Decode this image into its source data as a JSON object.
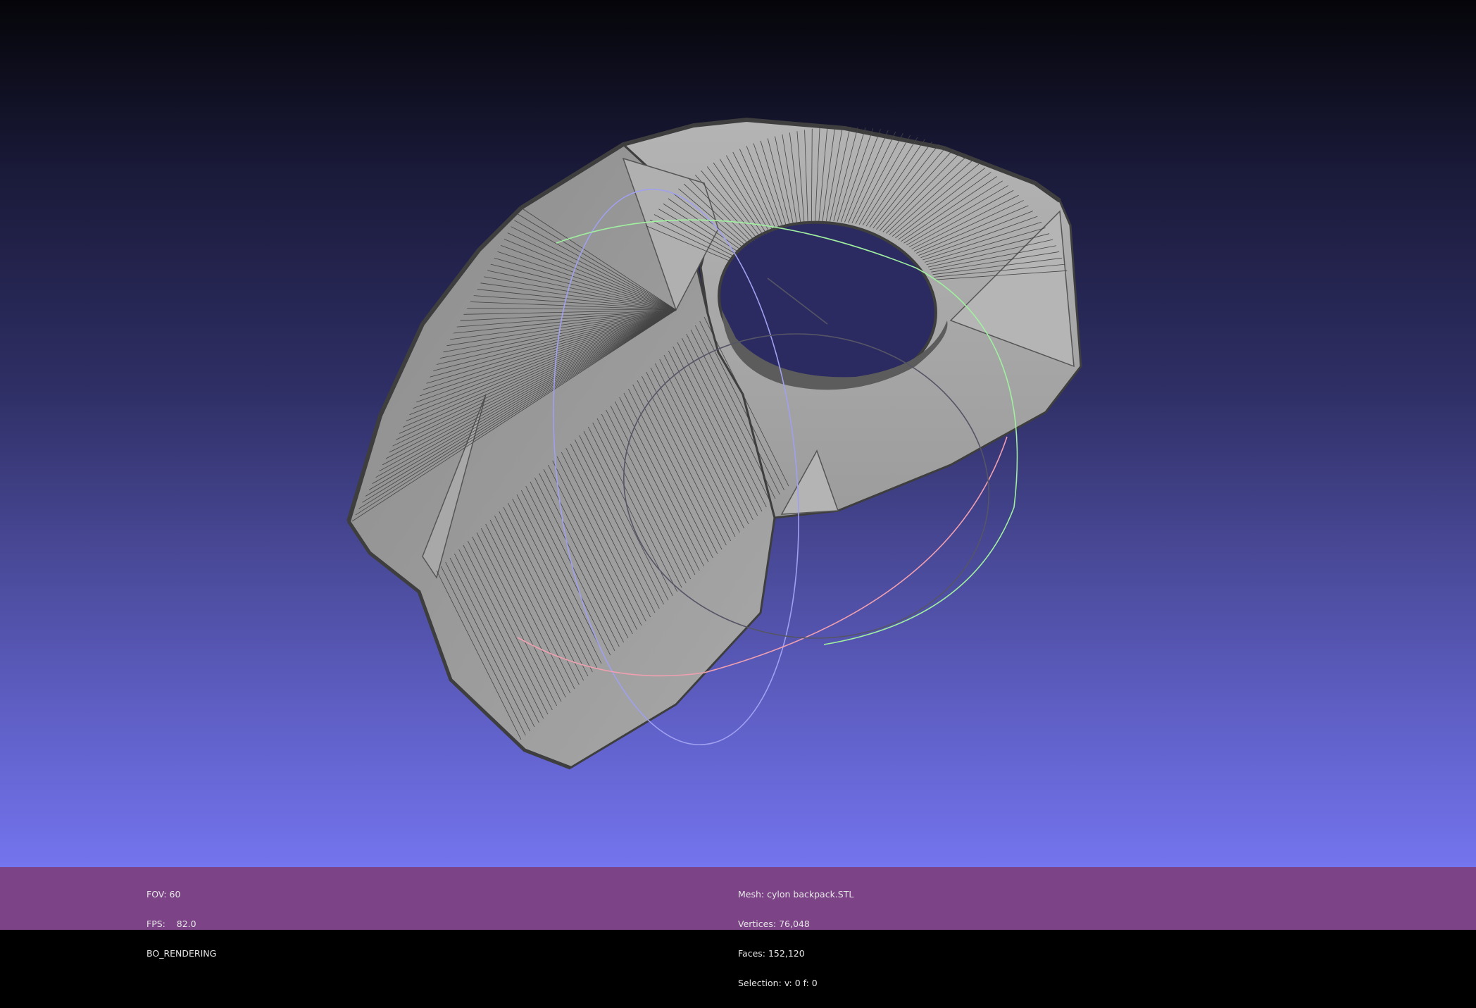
{
  "viewport": {
    "background_top": "#050509",
    "background_bottom": "#7474ee",
    "mesh_color": "#9a9a9a",
    "edge_color": "#3e3e3e",
    "trackball": {
      "x_ring_color": "#f0a0b0",
      "y_ring_color": "#a0f0a0",
      "z_ring_color": "#a0a0f0",
      "inactive_ring_color": "#555566"
    }
  },
  "status_bar": {
    "background": "#7c4486",
    "render_info": {
      "fov_label": "FOV:",
      "fov_value": "60",
      "fps_label": "FPS:",
      "fps_value": "82.0",
      "mode": "BO_RENDERING"
    },
    "mesh_info": {
      "mesh_label": "Mesh:",
      "mesh_name": "cylon backpack.STL",
      "vertices_label": "Vertices:",
      "vertices_value": "76,048",
      "faces_label": "Faces:",
      "faces_value": "152,120",
      "selection_label": "Selection:",
      "selection_value": "v: 0 f: 0"
    }
  }
}
